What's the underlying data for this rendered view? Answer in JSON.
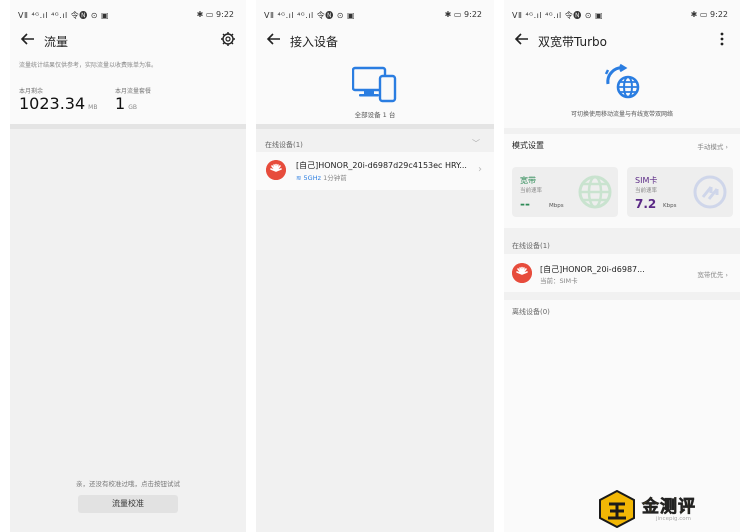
{
  "status_bar": {
    "carrier": "ⅤⅡ ⁴ᴳ.ıl ⁴ᴳ.ıl 令🅝 ⊙ ▣",
    "time": "9:22",
    "bt": "✱",
    "battery": "▭"
  },
  "screen1": {
    "title": "流量",
    "note": "流量统计结果仅供参考，实际流量以收费账单为准。",
    "remaining_label": "本月剩余",
    "remaining_value": "1023.34",
    "remaining_unit": "MB",
    "plan_label": "本月流量套餐",
    "plan_value": "1",
    "plan_unit": "GB",
    "hint": "亲，还没有校准过哦，点击按钮试试",
    "calibrate_button": "流量校准"
  },
  "screen2": {
    "title": "接入设备",
    "device_count": "全部设备 1 台",
    "online_section": "在线设备(1)",
    "device_name": "[自己]HONOR_20i-d6987d29c4153ec HRY...",
    "device_band": "5GHz",
    "device_time": "1分钟前"
  },
  "screen3": {
    "title": "双宽带Turbo",
    "description": "可切换使用移动流量与有线宽带双网络",
    "mode_title": "模式设置",
    "mode_value": "手动模式",
    "broadband": {
      "label": "宽带",
      "sub": "当前速率",
      "value": "--",
      "unit": "Mbps"
    },
    "sim": {
      "label": "SIM卡",
      "sub": "当前速率",
      "value": "7.2",
      "unit": "Kbps"
    },
    "online_section": "在线设备(1)",
    "device_name": "[自己]HONOR_20i-d6987...",
    "device_current": "当前：SIM卡",
    "device_pref": "宽带优先",
    "offline_section": "离线设备(0)"
  },
  "watermark": {
    "brand": "金测评",
    "url": "jincepig.com"
  },
  "colors": {
    "accent_blue": "#2a7de1",
    "broadband_green": "#2e8b57",
    "sim_purple": "#5b2a86",
    "avatar_red": "#e74c3c"
  }
}
